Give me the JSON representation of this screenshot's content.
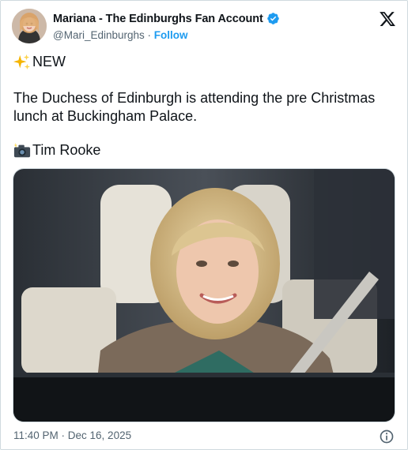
{
  "tweet": {
    "author": {
      "display_name": "Mariana - The Edinburghs Fan Account",
      "handle": "@Mari_Edinburghs",
      "separator": " · ",
      "follow_label": "Follow",
      "verified": true,
      "verified_color": "#1d9bf0"
    },
    "platform_icon": "x-logo-icon",
    "text": {
      "line1_emoji": "sparkles-icon",
      "line1": "NEW",
      "paragraph": "The Duchess of Edinburgh is attending the pre Christmas lunch at Buckingham Palace.",
      "credit_emoji": "camera-flash-icon",
      "credit": "Tim Rooke"
    },
    "media": {
      "description_icon": "photo"
    },
    "timestamp": "11:40 PM · Dec 16, 2025",
    "info_icon": "info-icon"
  }
}
